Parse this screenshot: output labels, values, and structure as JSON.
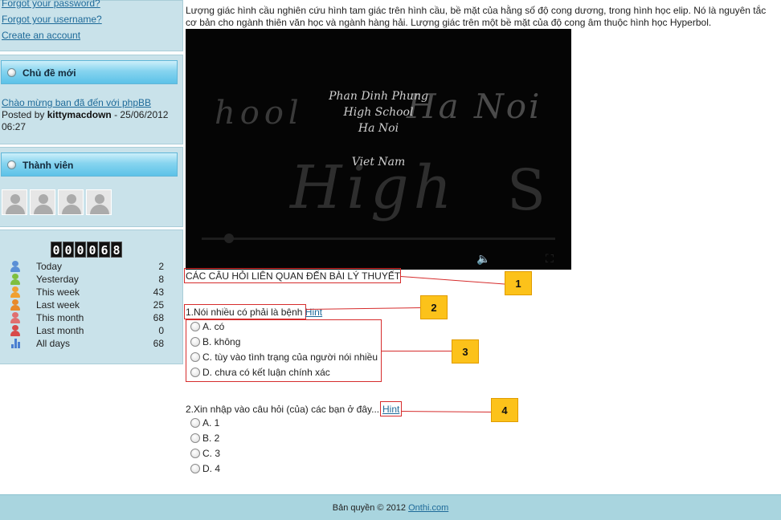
{
  "sidebar": {
    "links": [
      {
        "label": "Forgot your password?"
      },
      {
        "label": "Forgot your username?"
      },
      {
        "label": "Create an account"
      }
    ],
    "news": {
      "title": "Chủ đề mới",
      "post_link": "Chào mừng ban đã đến với phpBB",
      "posted_by": "Posted by",
      "author": "kittymacdown",
      "date": "- 25/06/2012 06:27"
    },
    "members": {
      "title": "Thành viên",
      "avatar_count": 4
    },
    "stats": {
      "counter_digits": [
        "0",
        "0",
        "0",
        "0",
        "6",
        "8"
      ],
      "rows": [
        {
          "label": "Today",
          "value": "2",
          "icon": "user-icon",
          "color": "#5a8fd6"
        },
        {
          "label": "Yesterday",
          "value": "8",
          "icon": "user-icon",
          "color": "#7fbf3f"
        },
        {
          "label": "This week",
          "value": "43",
          "icon": "user-icon",
          "color": "#f0a030"
        },
        {
          "label": "Last week",
          "value": "25",
          "icon": "user-icon",
          "color": "#e88a2a"
        },
        {
          "label": "This month",
          "value": "68",
          "icon": "user-icon",
          "color": "#e07070"
        },
        {
          "label": "Last month",
          "value": "0",
          "icon": "user-icon",
          "color": "#d84a4a"
        },
        {
          "label": "All days",
          "value": "68",
          "icon": "bar-chart-icon",
          "color": "#4a7fd1"
        }
      ]
    }
  },
  "main": {
    "intro": "Lượng giác hình cầu nghiên cứu hình tam giác trên hình cầu, bề mặt của hằng số độ cong dương, trong hình học elip. Nó là nguyên tắc cơ bản cho ngành thiên văn học và ngành hàng hải. Lượng giác trên một bề mặt của độ cong âm thuộc hình học Hyperbol.",
    "video": {
      "lines": [
        "Phan Dinh Phung",
        "High School",
        "Ha Noi",
        "Viet Nam"
      ],
      "background_words": [
        "hool",
        "Ha Noi",
        "High",
        "S"
      ]
    },
    "section_title": "CÁC CÂU HỎI LIÊN QUAN ĐẾN BÀI LÝ THUYẾT",
    "questions": [
      {
        "title": "1.Nói nhiều có phải là bệnh",
        "hint": "Hint",
        "options": [
          "A. có",
          "B. không",
          "C. tùy vào tình trạng của người nói nhiều",
          "D. chưa có kết luận chính xác"
        ]
      },
      {
        "title": "2.Xin nhập vào câu hỏi (của) các bạn ở đây...",
        "hint": "Hint",
        "options": [
          "A. 1",
          "B. 2",
          "C. 3",
          "D. 4"
        ]
      }
    ],
    "callouts": [
      "1",
      "2",
      "3",
      "4"
    ],
    "annotation_color": "#d62c2c",
    "callout_color": "#fcc21a"
  },
  "footer": {
    "copyright": "Bản quyền © 2012",
    "link": "Onthi.com"
  }
}
